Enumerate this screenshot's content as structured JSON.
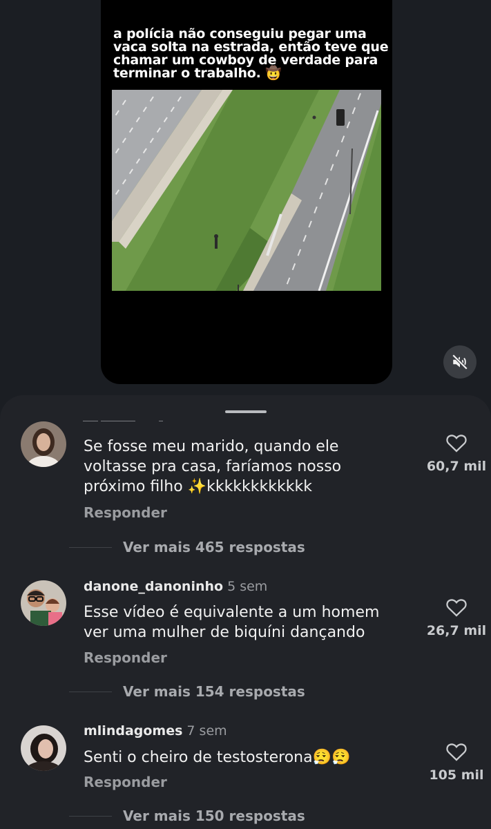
{
  "video": {
    "caption": "a polícia não conseguiu pegar uma vaca solta na estrada, então teve que chamar um cowboy de verdade para terminar o trabalho. 🤠",
    "mute_icon": "speaker-muted-icon"
  },
  "comments": [
    {
      "username": "",
      "time": "",
      "text": "Se fosse meu marido, quando ele voltasse pra casa, faríamos nosso próximo filho ✨kkkkkkkkkkkk",
      "reply_label": "Responder",
      "likes": "60,7 mil",
      "more_replies": "Ver mais 465 respostas"
    },
    {
      "username": "danone_danoninho",
      "time": "5 sem",
      "text": "Esse vídeo é equivalente a um homem ver uma mulher de biquíni dançando",
      "reply_label": "Responder",
      "likes": "26,7 mil",
      "more_replies": "Ver mais 154 respostas"
    },
    {
      "username": "mlindagomes",
      "time": "7 sem",
      "text": "Senti o cheiro de testosterona😮‍💨😮‍💨",
      "reply_label": "Responder",
      "likes": "105 mil",
      "more_replies": "Ver mais 150 respostas"
    }
  ],
  "colors": {
    "background": "#1b1e23",
    "sheet": "#212328",
    "secondary_text": "#9a9ca0"
  }
}
